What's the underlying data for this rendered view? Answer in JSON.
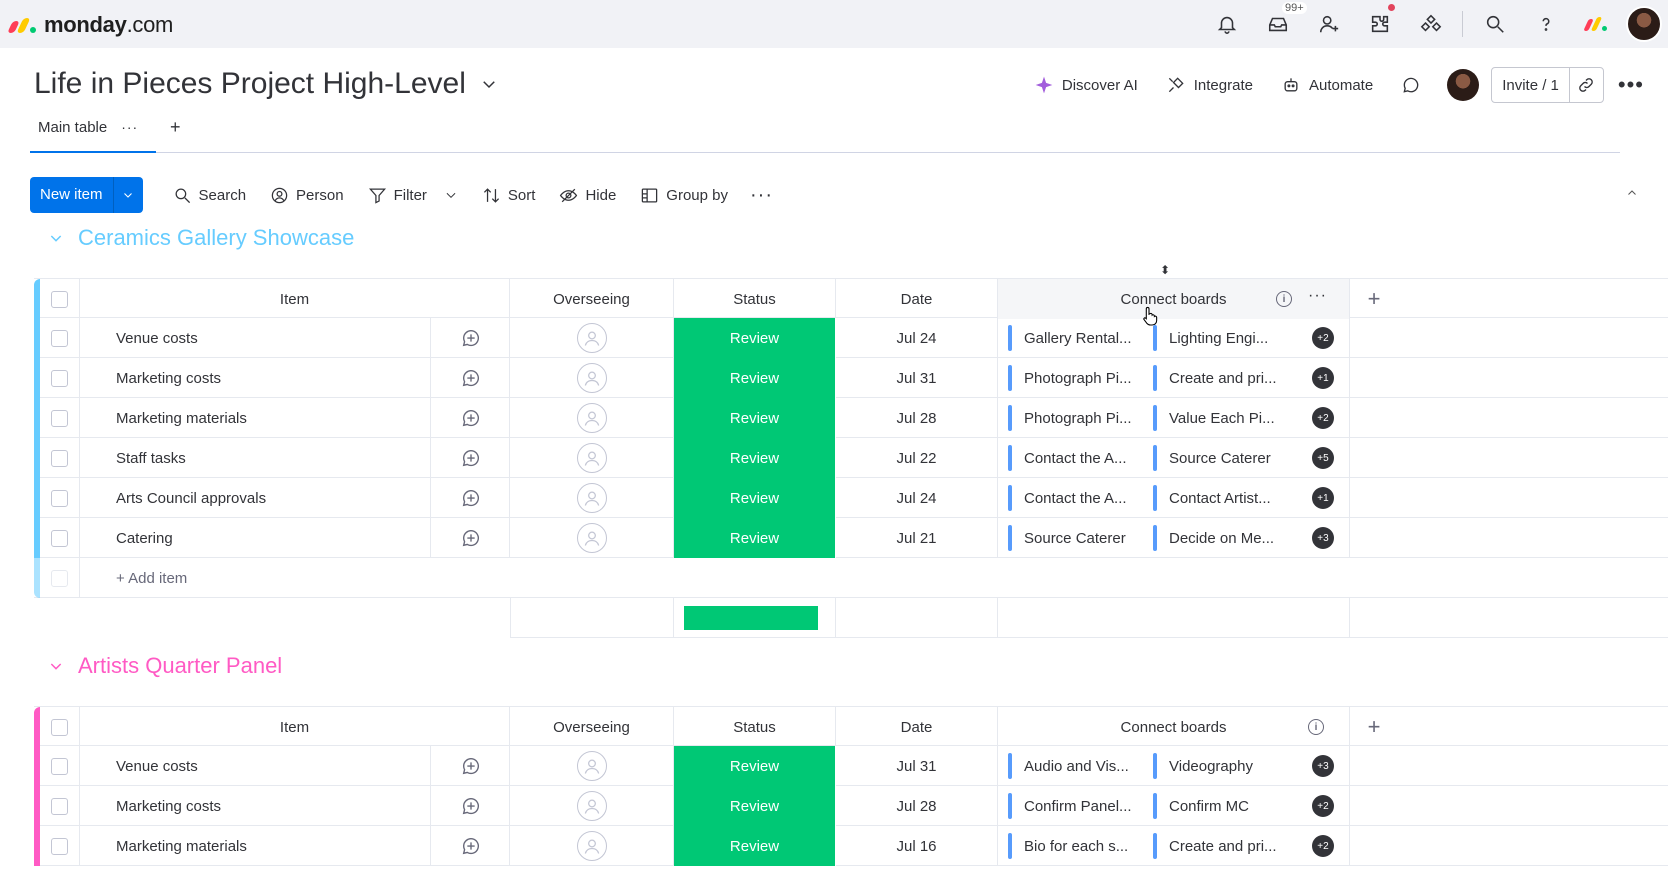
{
  "app": {
    "logo_bold": "monday",
    "logo_light": ".com",
    "logo_colors": [
      "#ff3d57",
      "#ffcb00",
      "#00ca72"
    ],
    "notifications_badge": "99+",
    "top_icons": [
      "bell-icon",
      "inbox-icon",
      "invite-members-icon",
      "marketplace-icon",
      "products-icon",
      "search-icon",
      "help-icon"
    ]
  },
  "board": {
    "title": "Life in Pieces Project High-Level",
    "actions": {
      "discover_ai": "Discover AI",
      "integrate": "Integrate",
      "automate": "Automate",
      "invite": "Invite / 1"
    },
    "tabs": [
      {
        "label": "Main table"
      }
    ],
    "add_tab": "+"
  },
  "toolbar": {
    "new_item": "New item",
    "search": "Search",
    "person": "Person",
    "filter": "Filter",
    "sort": "Sort",
    "hide": "Hide",
    "group_by": "Group by"
  },
  "columns": {
    "item": "Item",
    "overseeing": "Overseeing",
    "status": "Status",
    "date": "Date",
    "connect_boards": "Connect boards",
    "info": "i",
    "add_column": "+"
  },
  "groups": [
    {
      "name": "Ceramics Gallery Showcase",
      "color": "#66ccff",
      "add_item": "+ Add item",
      "rows": [
        {
          "item": "Venue costs",
          "status": "Review",
          "date": "Jul 24",
          "conn1": "Gallery Rental...",
          "conn2": "Lighting Engi...",
          "extra": "+2"
        },
        {
          "item": "Marketing costs",
          "status": "Review",
          "date": "Jul 31",
          "conn1": "Photograph Pi...",
          "conn2": "Create and pri...",
          "extra": "+1"
        },
        {
          "item": "Marketing materials",
          "status": "Review",
          "date": "Jul 28",
          "conn1": "Photograph Pi...",
          "conn2": "Value Each Pi...",
          "extra": "+2"
        },
        {
          "item": "Staff tasks",
          "status": "Review",
          "date": "Jul 22",
          "conn1": "Contact the A...",
          "conn2": "Source Caterer",
          "extra": "+5"
        },
        {
          "item": "Arts Council approvals",
          "status": "Review",
          "date": "Jul 24",
          "conn1": "Contact the A...",
          "conn2": "Contact Artist...",
          "extra": "+1"
        },
        {
          "item": "Catering",
          "status": "Review",
          "date": "Jul 21",
          "conn1": "Source Caterer",
          "conn2": "Decide on Me...",
          "extra": "+3"
        }
      ]
    },
    {
      "name": "Artists Quarter Panel",
      "color": "#ff5ac4",
      "rows": [
        {
          "item": "Venue costs",
          "status": "Review",
          "date": "Jul 31",
          "conn1": "Audio and Vis...",
          "conn2": "Videography",
          "extra": "+3"
        },
        {
          "item": "Marketing costs",
          "status": "Review",
          "date": "Jul 28",
          "conn1": "Confirm Panel...",
          "conn2": "Confirm MC",
          "extra": "+2"
        },
        {
          "item": "Marketing materials",
          "status": "Review",
          "date": "Jul 16",
          "conn1": "Bio for each s...",
          "conn2": "Create and pri...",
          "extra": "+2"
        }
      ]
    }
  ],
  "colors": {
    "primary": "#0073ea",
    "status_review": "#00c875",
    "connect_chip": "#579bfc"
  }
}
